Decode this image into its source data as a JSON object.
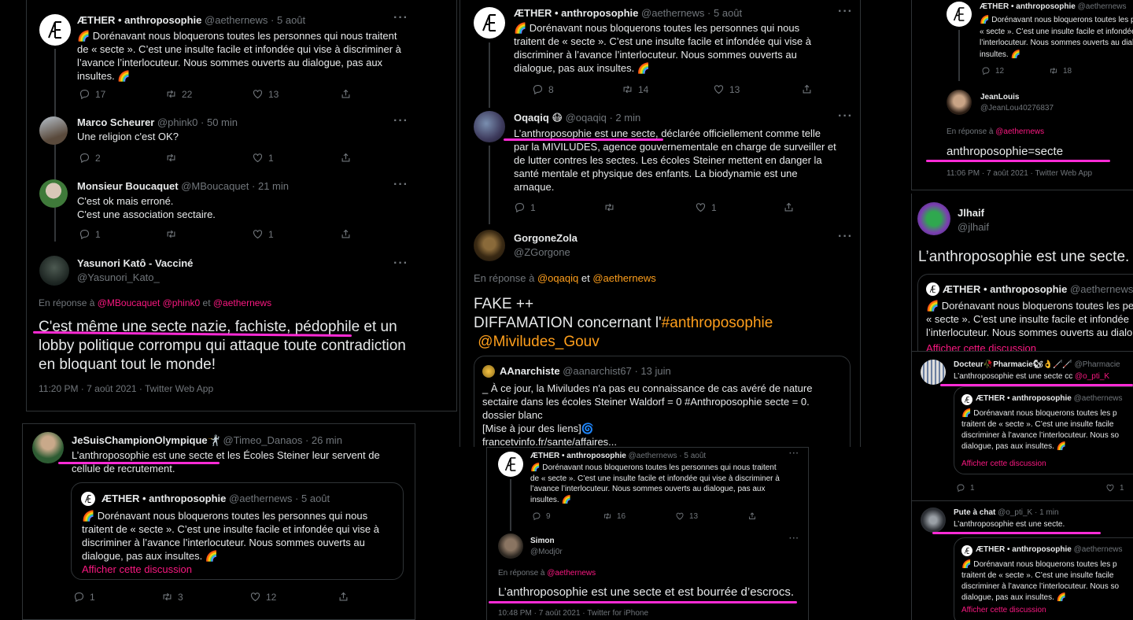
{
  "colors": {
    "highlight": "#ff2bd6",
    "reply_link": "#f91880",
    "hashtag": "#ff9f1c",
    "muted": "#71767b",
    "text": "#e7e9ea"
  },
  "icons": [
    "reply-icon",
    "retweet-icon",
    "like-icon",
    "share-icon",
    "more-icon",
    "rainbow-emoji"
  ],
  "aether_tweet": {
    "name": "ÆTHER • anthroposophie",
    "handle": "@aethernews",
    "date": "5 août",
    "text": "🌈 Dorénavant nous bloquerons toutes les personnes qui nous traitent de « secte ». C’est une insulte facile et infondée qui vise à discriminer à l’avance l’interlocuteur. Nous sommes ouverts au dialogue, pas aux insultes. 🌈"
  },
  "p1": {
    "main": {
      "l1": "🌈 Dorénavant nous bloquerons toutes les personnes qui nous traitent",
      "l2": "de « secte ». C’est une insulte facile et infondée qui vise à discriminer à",
      "l3": "l’avance l’interlocuteur. Nous sommes ouverts au dialogue, pas aux",
      "l4": "insultes. 🌈",
      "replies": "17",
      "retweets": "22",
      "likes": "13"
    },
    "t2": {
      "name": "Marco Scheurer",
      "handle": "@phink0",
      "time": "· 50 min",
      "text": "Une religion c'est OK?",
      "replies": "2",
      "likes": "1"
    },
    "t3": {
      "name": "Monsieur Boucaquet",
      "handle": "@MBoucaquet",
      "time": "· 21 min",
      "l1": "C'est ok mais erroné.",
      "l2": "C'est une association sectaire.",
      "replies": "1",
      "likes": "1"
    },
    "t4": {
      "name": "Yasunori Katô - Vacciné",
      "handle": "@Yasunori_Kato_",
      "reply_prefix": "En réponse à",
      "reply_to": "@MBoucaquet @phink0",
      "reply_and": "et",
      "reply_to2": "@aethernews",
      "l1": "C'est même une secte nazie, fachiste, pédophile et un",
      "l2": "lobby politique corrompu qui attaque toute contradiction",
      "l3": "en bloquant tout le monde!",
      "meta": "11:20 PM · 7 août 2021 · Twitter Web App"
    }
  },
  "p2": {
    "name": "JeSuisChampionOlympique🤺",
    "handle": "@Timeo_Danaos",
    "time": "· 26 min",
    "l1": "L’anthroposophie est une secte et les Écoles Steiner leur servent de",
    "l2": "cellule de recrutement.",
    "quote": {
      "l1": "🌈 Dorénavant nous bloquerons toutes les personnes qui nous",
      "l2": "traitent de « secte ». C’est une insulte facile et infondée qui vise à",
      "l3": "discriminer à l’avance l’interlocuteur. Nous sommes ouverts au",
      "l4": "dialogue, pas aux insultes. 🌈"
    },
    "show_thread": "Afficher cette discussion",
    "replies": "1",
    "retweets": "3",
    "likes": "12"
  },
  "p3": {
    "main": {
      "l1": "🌈 Dorénavant nous bloquerons toutes les personnes qui nous",
      "l2": "traitent de « secte ». C’est une insulte facile et infondée qui vise à",
      "l3": "discriminer à l’avance l’interlocuteur. Nous sommes ouverts au",
      "l4": "dialogue, pas aux insultes. 🌈",
      "replies": "8",
      "retweets": "14",
      "likes": "13"
    },
    "oq": {
      "name": "Oqaqiq 😷",
      "handle": "@oqaqiq",
      "time": "· 2 min",
      "l1": "L’anthroposophie est une secte, déclarée officiellement comme telle",
      "l2": "par la MIVILUDES, agence gouvernementale en charge de surveiller et",
      "l3": "de lutter contres les sectes. Les écoles Steiner mettent en danger la",
      "l4": "santé mentale et physique des enfants. La biodynamie est une",
      "l5": "arnaque.",
      "replies": "1",
      "likes": "1"
    },
    "gz": {
      "name": "GorgoneZola",
      "handle": "@ZGorgone",
      "reply_prefix": "En réponse à",
      "reply_to": "@oqaqiq",
      "reply_and": "et",
      "reply_to2": "@aethernews",
      "l1": "FAKE ++",
      "l2a": "DIFFAMATION concernant l'",
      "l2b": "#anthroposophie",
      "l3": "@Miviludes_Gouv"
    },
    "quote": {
      "name": "AAnarchiste",
      "handle": "@aanarchist67",
      "date": "· 13 juin",
      "l1": "_ À ce jour, la Miviludes n'a pas eu connaissance de cas avéré de nature",
      "l2": "sectaire dans les écoles Steiner Waldorf = 0 #Anthroposophie secte = 0.",
      "l3": "dossier blanc",
      "l4": "[Mise à jour des liens]🌀",
      "l5": "francetvinfo.fr/sante/affaires..."
    }
  },
  "p4": {
    "main": {
      "l1": "🌈 Dorénavant nous bloquerons toutes les personnes qui nous traitent",
      "l2": "de « secte ». C’est une insulte facile et infondée qui vise à discriminer à",
      "l3": "l’avance l’interlocuteur. Nous sommes ouverts au dialogue, pas aux",
      "l4": "insultes. 🌈",
      "replies": "9",
      "retweets": "16",
      "likes": "13"
    },
    "simon": {
      "name": "Simon",
      "handle": "@Modj0r",
      "reply_prefix": "En réponse à",
      "reply_to": "@aethernews",
      "text": "L’anthroposophie est une secte et est bourrée d’escrocs.",
      "meta": "10:48 PM · 7 août 2021 · Twitter for iPhone"
    }
  },
  "p5": {
    "main": {
      "l1": "🌈 Dorénavant nous bloquerons toutes les pe",
      "l2": "« secte ». C’est une insulte facile et infondée",
      "l3": "l’interlocuteur. Nous sommes ouverts au dialo",
      "l4": "insultes. 🌈",
      "replies": "12",
      "retweets": "18"
    },
    "jl": {
      "name": "JeanLouis",
      "handle": "@JeanLou40276837",
      "reply_prefix": "En réponse à",
      "reply_to": "@aethernews",
      "text": "anthroposophie=secte",
      "meta": "11:06 PM · 7 août 2021 · Twitter Web App"
    }
  },
  "p6": {
    "name": "Jlhaif",
    "handle": "@jlhaif",
    "text": "L’anthroposophie est une secte.",
    "quote": {
      "name": "ÆTHER • anthroposophie",
      "handle": "@aethernews",
      "l1": "🌈 Dorénavant nous bloquerons toutes les pe",
      "l2": "« secte ». C’est une insulte facile et infondée",
      "l3": "l’interlocuteur. Nous sommes ouverts au dialo",
      "show_thread": "Afficher cette discussion"
    }
  },
  "p7": {
    "dp": {
      "name": "Docteur🥀Pharmacie🐿👌🦯🦯",
      "handle": "@Pharmacie",
      "text_a": "L’anthroposophie est une secte cc",
      "text_b": "@o_pti_K"
    },
    "quote": {
      "name": "ÆTHER • anthroposophie",
      "handle": "@aethernews",
      "l1": "🌈 Dorénavant nous bloquerons toutes les p",
      "l2": "traitent de « secte ». C’est une insulte facile",
      "l3": "discriminer à l’avance l’interlocuteur. Nous so",
      "l4": "dialogue, pas aux insultes. 🌈",
      "show_thread": "Afficher cette discussion",
      "replies": "1",
      "likes": "1"
    },
    "pc": {
      "name": "Pute à chat",
      "handle": "@o_pti_K",
      "time": "· 1 min",
      "text": "L’anthroposophie est une secte."
    },
    "quote2": {
      "name": "ÆTHER • anthroposophie",
      "handle": "@aethernews",
      "l1": "🌈 Dorénavant nous bloquerons toutes les p",
      "l2": "traitent de « secte ». C’est une insulte facile",
      "l3": "discriminer à l’avance l’interlocuteur. Nous so",
      "l4": "dialogue, pas aux insultes. 🌈",
      "show_thread": "Afficher cette discussion"
    }
  }
}
